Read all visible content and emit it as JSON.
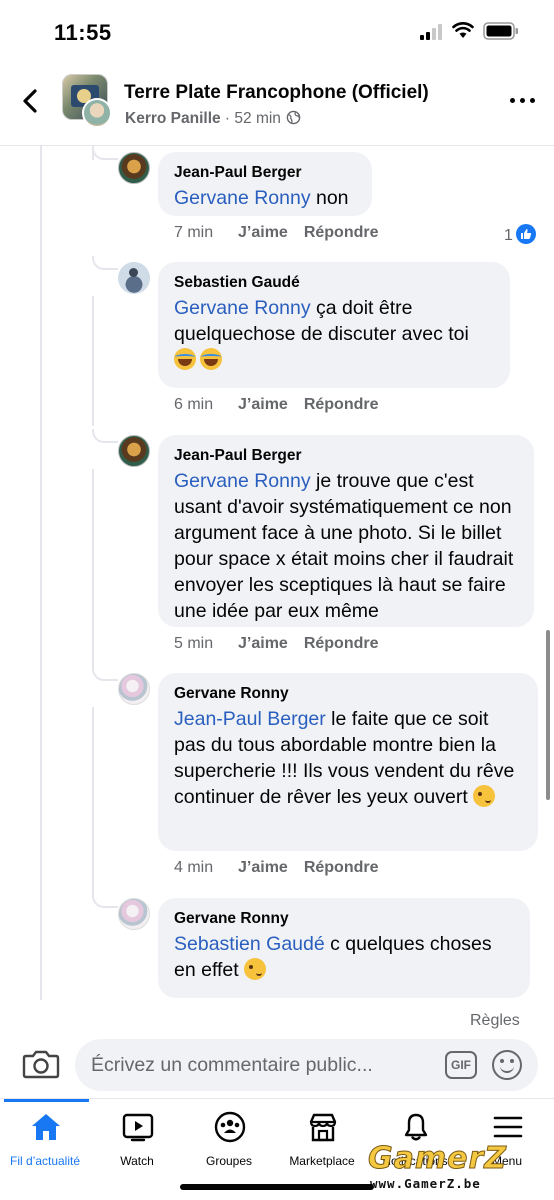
{
  "status_bar": {
    "time": "11:55"
  },
  "header": {
    "title": "Terre Plate Francophone (Officiel)",
    "author": "Kerro Panille",
    "separator": " · ",
    "elapsed": "52 min"
  },
  "comments": [
    {
      "author": "Jean-Paul Berger",
      "mention": "Gervane Ronny",
      "text": " non",
      "time": "7 min",
      "like_label": "J’aime",
      "reply_label": "Répondre",
      "reaction_count": "1"
    },
    {
      "author": "Sebastien Gaudé",
      "mention": "Gervane Ronny",
      "text": " ça doit être quelquechose de discuter avec toi",
      "emoji": [
        "laugh-cry",
        "laugh-cry"
      ],
      "time": "6 min",
      "like_label": "J’aime",
      "reply_label": "Répondre"
    },
    {
      "author": "Jean-Paul Berger",
      "mention": "Gervane Ronny",
      "text": " je trouve que c'est usant d'avoir systématiquement ce non argument face à une photo. Si le billet pour space x était moins cher il faudrait envoyer les sceptiques là haut se faire une idée par eux même",
      "time": "5 min",
      "like_label": "J’aime",
      "reply_label": "Répondre"
    },
    {
      "author": "Gervane Ronny",
      "mention": "Jean-Paul Berger",
      "text": " le faite que ce soit pas du tous abordable montre bien la supercherie !!! Ils vous vendent du rêve continuer de rêver les yeux ouvert",
      "emoji": [
        "wink"
      ],
      "time": "4 min",
      "like_label": "J’aime",
      "reply_label": "Répondre"
    },
    {
      "author": "Gervane Ronny",
      "mention": "Sebastien Gaudé",
      "text": " c quelques choses en effet",
      "emoji": [
        "wink"
      ]
    }
  ],
  "rules_label": "Règles",
  "composer": {
    "placeholder": "Écrivez un commentaire public...",
    "gif_label": "GIF"
  },
  "bottom_nav": [
    {
      "label": "Fil d’actualité",
      "icon": "home-icon",
      "active": true
    },
    {
      "label": "Watch",
      "icon": "watch-icon",
      "active": false
    },
    {
      "label": "Groupes",
      "icon": "groups-icon",
      "active": false
    },
    {
      "label": "Marketplace",
      "icon": "marketplace-icon",
      "active": false
    },
    {
      "label": "Notifications",
      "icon": "bell-icon",
      "active": false
    },
    {
      "label": "Menu",
      "icon": "menu-icon",
      "active": false
    }
  ],
  "watermark": {
    "logo": "GamerZ",
    "url": "www.GamerZ.be"
  },
  "colors": {
    "accent": "#1877f2",
    "mention": "#2a5fbf",
    "bubble": "#f0f2f5",
    "secondary_text": "#65676b"
  }
}
